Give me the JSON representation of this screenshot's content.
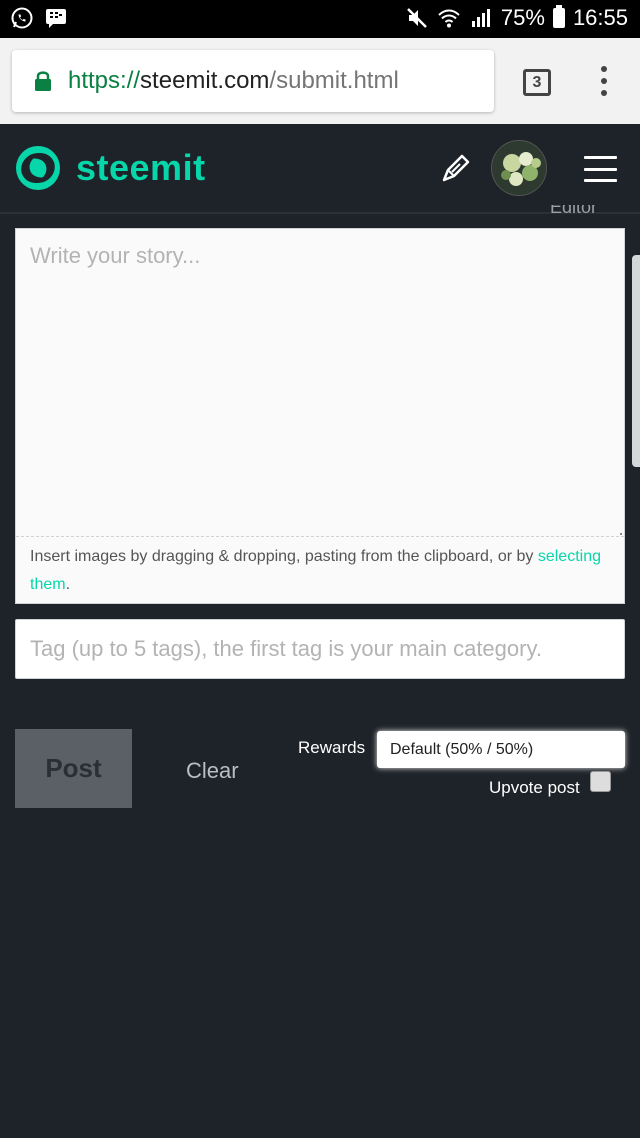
{
  "status_bar": {
    "battery": "75%",
    "time": "16:55"
  },
  "browser": {
    "url_scheme": "https://",
    "url_host": "steemit.com",
    "url_path": "/submit.html",
    "tab_count": "3"
  },
  "header": {
    "logo_text": "steemit"
  },
  "editor": {
    "label": "Editor",
    "story_placeholder": "Write your story...",
    "upload_hint_prefix": "Insert images by dragging & dropping, pasting from the clipboard, or by ",
    "upload_hint_link": "selecting them",
    "upload_hint_suffix": ".",
    "tags_placeholder": "Tag (up to 5 tags), the first tag is your main category."
  },
  "actions": {
    "post_label": "Post",
    "clear_label": "Clear",
    "rewards_label": "Rewards",
    "rewards_value": "Default (50% / 50%)",
    "upvote_label": "Upvote post"
  },
  "colors": {
    "accent": "#06d6a9",
    "background": "#1e2329"
  }
}
